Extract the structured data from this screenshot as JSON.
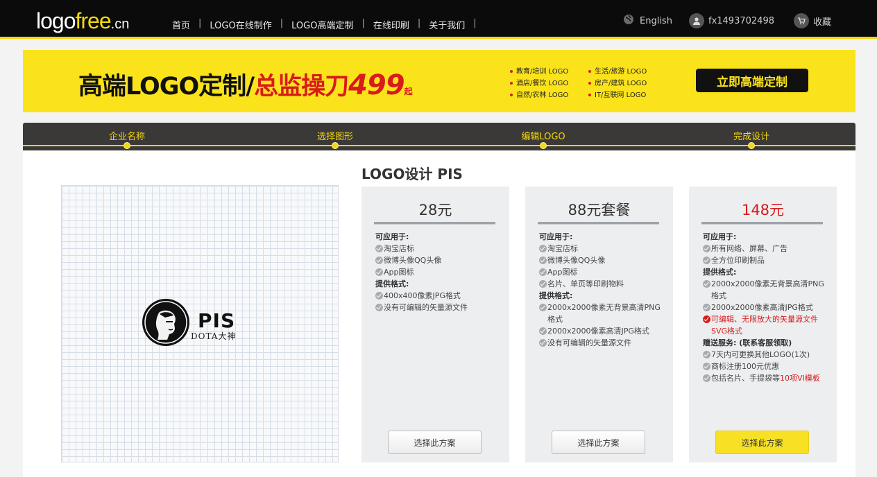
{
  "header": {
    "logo": {
      "main": "logo",
      "accent": "free",
      "suffix": ".cn"
    },
    "nav": [
      "首页",
      "LOGO在线制作",
      "LOGO高端定制",
      "在线印刷",
      "关于我们"
    ],
    "language": "English",
    "username": "fx1493702498",
    "favorites": "收藏"
  },
  "banner": {
    "title_black": "高端LOGO定制/",
    "title_red": "总监操刀",
    "price": "499",
    "price_suffix": "起",
    "categories": [
      "教育/培训 LOGO",
      "酒店/餐饮 LOGO",
      "自然/农林 LOGO",
      "生活/旅游 LOGO",
      "房产/建筑 LOGO",
      "IT/互联网 LOGO"
    ],
    "cta": "立即高端定制"
  },
  "steps": [
    "企业名称",
    "选择图形",
    "编辑LOGO",
    "完成设计"
  ],
  "page_title": "LOGO设计 PIS",
  "preview": {
    "name": "PIS",
    "subtitle": "DOTA大神"
  },
  "plans": [
    {
      "price": "28元",
      "use_heading": "可应用于:",
      "uses": [
        "淘宝店标",
        "微博头像QQ头像",
        "App图标"
      ],
      "format_heading": "提供格式:",
      "formats": [
        "400x400像素JPG格式",
        "没有可编辑的矢量源文件"
      ],
      "button": "选择此方案"
    },
    {
      "price": "88元套餐",
      "use_heading": "可应用于:",
      "uses": [
        "淘宝店标",
        "微博头像QQ头像",
        "App图标",
        "名片、单页等印刷物料"
      ],
      "format_heading": "提供格式:",
      "formats": [
        "2000x2000像素无背景高清PNG格式",
        "2000x2000像素高清JPG格式",
        "没有可编辑的矢量源文件"
      ],
      "button": "选择此方案"
    },
    {
      "price": "148元",
      "use_heading": "可应用于:",
      "uses": [
        "所有网络、屏幕、广告",
        "全方位印刷制品"
      ],
      "format_heading": "提供格式:",
      "formats": [
        "2000x2000像素无背景高清PNG格式",
        "2000x2000像素高清JPG格式",
        "可编辑、无限放大的矢量源文件SVG格式"
      ],
      "gift_heading": "赠送服务:  (联系客服领取)",
      "gifts": [
        "7天内可更换其他LOGO(1次)",
        "商标注册100元优惠"
      ],
      "gift_last_prefix": "包括名片、手提袋等",
      "gift_last_highlight": "10项VI模板",
      "button": "选择此方案"
    }
  ],
  "colors": {
    "brand_yellow": "#f5d90a",
    "price_red": "#d81b1b",
    "header_black": "#0b0b0b"
  }
}
